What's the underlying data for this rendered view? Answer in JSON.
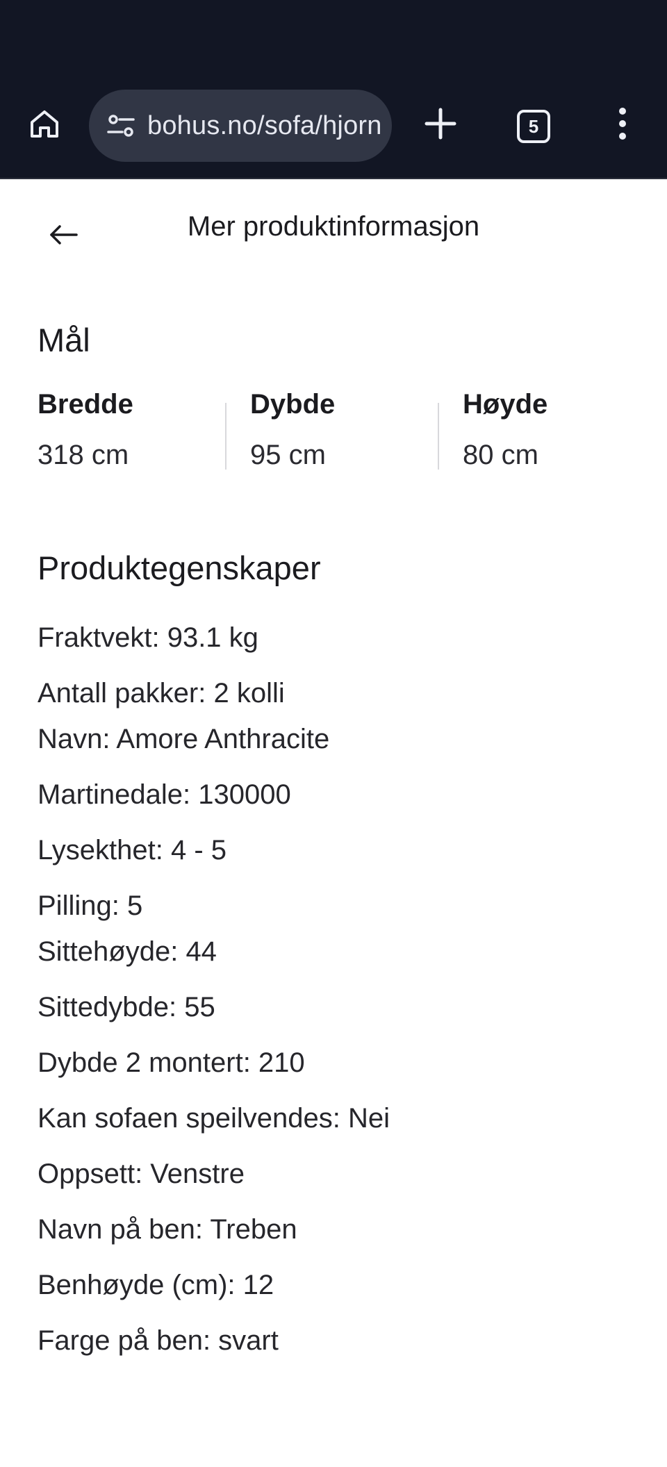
{
  "browser": {
    "url": "bohus.no/sofa/hjorn",
    "tab_count": "5"
  },
  "header": {
    "title": "Mer produktinformasjon"
  },
  "dimensions": {
    "title": "Mål",
    "items": [
      {
        "label": "Bredde",
        "value": "318 cm"
      },
      {
        "label": "Dybde",
        "value": "95 cm"
      },
      {
        "label": "Høyde",
        "value": "80 cm"
      }
    ]
  },
  "properties": {
    "title": "Produktegenskaper",
    "items": [
      "Fraktvekt: 93.1 kg",
      "Antall pakker: 2 kolli",
      "Navn: Amore Anthracite",
      "Martinedale: 130000",
      "Lysekthet: 4 - 5",
      "Pilling: 5",
      "Sittehøyde: 44",
      "Sittedybde: 55",
      "Dybde 2 montert: 210",
      "Kan sofaen speilvendes: Nei",
      "Oppsett: Venstre",
      "Navn på ben: Treben",
      "Benhøyde (cm): 12",
      "Farge på ben: svart"
    ]
  }
}
